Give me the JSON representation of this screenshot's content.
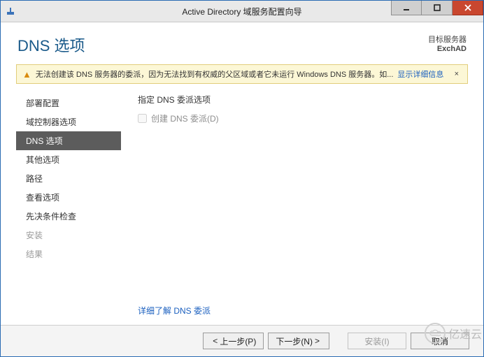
{
  "titlebar": {
    "title": "Active Directory 域服务配置向导"
  },
  "header": {
    "page_title": "DNS 选项",
    "target_label": "目标服务器",
    "target_server": "ExchAD"
  },
  "warning": {
    "text": "无法创建该 DNS 服务器的委派，因为无法找到有权威的父区域或者它未运行 Windows DNS 服务器。如...",
    "more": "显示详细信息",
    "close": "×"
  },
  "sidebar": {
    "items": [
      {
        "label": "部署配置"
      },
      {
        "label": "域控制器选项"
      },
      {
        "label": "DNS 选项"
      },
      {
        "label": "其他选项"
      },
      {
        "label": "路径"
      },
      {
        "label": "查看选项"
      },
      {
        "label": "先决条件检查"
      },
      {
        "label": "安装"
      },
      {
        "label": "结果"
      }
    ]
  },
  "main": {
    "section_title": "指定 DNS 委派选项",
    "checkbox_label": "创建 DNS 委派(D)",
    "learn_more": "详细了解 DNS 委派"
  },
  "footer": {
    "prev": "上一步(P)",
    "next": "下一步(N)",
    "install": "安装(I)",
    "cancel": "取消"
  },
  "watermark": "亿速云"
}
